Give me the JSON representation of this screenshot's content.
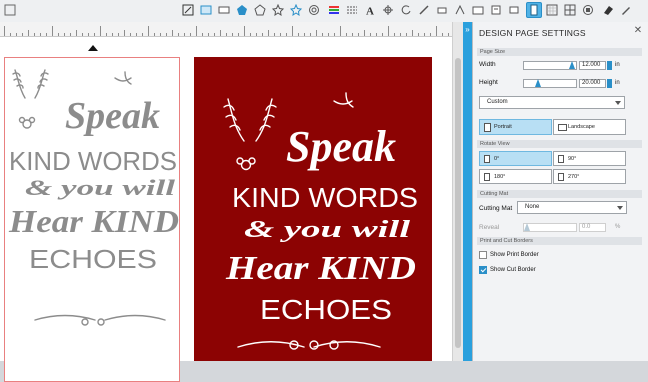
{
  "toolbar": {
    "icons": [
      "arrange-icon",
      "rectangle-icon",
      "pentagon-icon",
      "polygon-icon",
      "star-icon",
      "heart-icon",
      "spiral-icon",
      "image-icon",
      "line-style-icon",
      "fill-pattern-icon",
      "text-icon",
      "offset-icon",
      "rotate-icon",
      "transform-icon",
      "knife-icon",
      "trace-icon",
      "cut-settings-icon",
      "library-icon",
      "store-icon",
      "send-icon",
      "page-settings-icon",
      "grid-icon",
      "align-icon",
      "eraser-icon",
      "pen-icon"
    ]
  },
  "canvas": {
    "design_text": {
      "line1": "Speak",
      "line2": "KIND WORDS",
      "line3": "& you will",
      "line4": "Hear KIND",
      "line5": "ECHOES"
    },
    "background_color": "#8c0303"
  },
  "panel": {
    "title": "DESIGN PAGE SETTINGS",
    "page_size": {
      "section": "Page Size",
      "width_label": "Width",
      "width_value": "12.000",
      "width_unit": "in",
      "height_label": "Height",
      "height_value": "20.000",
      "height_unit": "in",
      "preset": "Custom",
      "portrait_label": "Portrait",
      "landscape_label": "Landscape"
    },
    "rotate_view": {
      "section": "Rotate View",
      "options": [
        "0°",
        "90°",
        "180°",
        "270°"
      ]
    },
    "cutting_mat": {
      "section": "Cutting Mat",
      "label": "Cutting Mat",
      "value": "None",
      "reveal_label": "Reveal",
      "reveal_value": "0.0",
      "reveal_unit": "%"
    },
    "borders": {
      "section": "Print and Cut Borders",
      "show_print_border": "Show Print Border",
      "show_cut_border": "Show Cut Border"
    }
  }
}
